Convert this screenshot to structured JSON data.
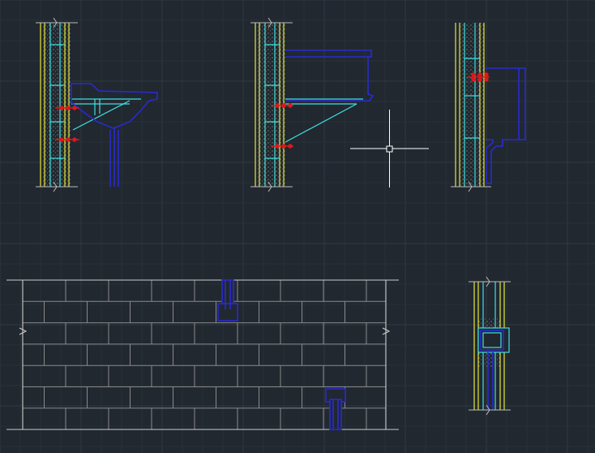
{
  "app": {
    "type": "cad-model-space",
    "view": "2D wireframe"
  },
  "colors": {
    "background": "#212830",
    "grid_minor": "#283039",
    "grid_major": "#303a45",
    "wall_yellow": "#d8d83a",
    "wall_cyan": "#3fe0e0",
    "fixture_blue": "#2a2ad0",
    "anchor_red": "#e01818",
    "brick_gray": "#8a8a8a",
    "crosshair": "#ffffff",
    "hatch": "#c8c8a0"
  },
  "drawings": [
    {
      "name": "wall-section-washbasin-bracket",
      "fixture": "washbasin"
    },
    {
      "name": "wall-section-sink-bracket",
      "fixture": "sink"
    },
    {
      "name": "wall-section-cistern",
      "fixture": "cistern"
    },
    {
      "name": "brick-wall-elevation",
      "fixture": "pipe-stubs"
    },
    {
      "name": "wall-section-small-fixture",
      "fixture": "box"
    }
  ],
  "cursor": {
    "mode": "crosshair-pickbox"
  }
}
